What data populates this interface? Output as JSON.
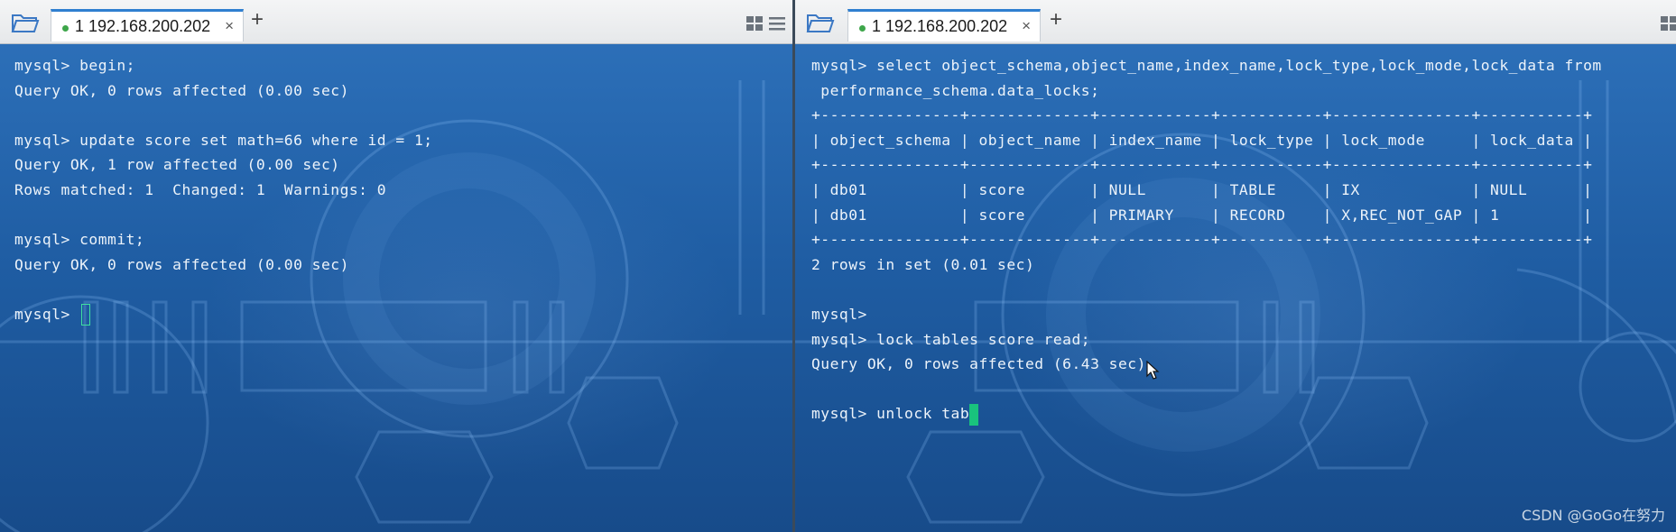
{
  "left_pane": {
    "tab": {
      "title": "1 192.168.200.202",
      "close": "×"
    },
    "new_tab": "+",
    "lines": [
      "mysql> begin;",
      "Query OK, 0 rows affected (0.00 sec)",
      "",
      "mysql> update score set math=66 where id = 1;",
      "Query OK, 1 row affected (0.00 sec)",
      "Rows matched: 1  Changed: 1  Warnings: 0",
      "",
      "mysql> commit;",
      "Query OK, 0 rows affected (0.00 sec)",
      ""
    ],
    "prompt": "mysql> "
  },
  "right_pane": {
    "tab": {
      "title": "1 192.168.200.202",
      "close": "×"
    },
    "new_tab": "+",
    "lines": [
      "mysql> select object_schema,object_name,index_name,lock_type,lock_mode,lock_data from",
      " performance_schema.data_locks;",
      "+---------------+-------------+------------+-----------+---------------+-----------+",
      "| object_schema | object_name | index_name | lock_type | lock_mode     | lock_data |",
      "+---------------+-------------+------------+-----------+---------------+-----------+",
      "| db01          | score       | NULL       | TABLE     | IX            | NULL      |",
      "| db01          | score       | PRIMARY    | RECORD    | X,REC_NOT_GAP | 1         |",
      "+---------------+-------------+------------+-----------+---------------+-----------+",
      "2 rows in set (0.01 sec)",
      "",
      "mysql>",
      "mysql> lock tables score read;",
      "Query OK, 0 rows affected (6.43 sec)",
      ""
    ],
    "current_input": "mysql> unlock tab"
  },
  "watermark": "CSDN @GoGo在努力",
  "colors": {
    "terminal_bg": "#1f5da3",
    "terminal_text": "#ecf3fa",
    "tab_accent": "#2f7fd0",
    "cursor": "#19c37d"
  },
  "icons": [
    "open-folder-icon",
    "connection-status-dot-icon",
    "close-tab-icon",
    "new-tab-icon",
    "tile-layout-icon",
    "menu-icon",
    "mouse-pointer-icon"
  ]
}
